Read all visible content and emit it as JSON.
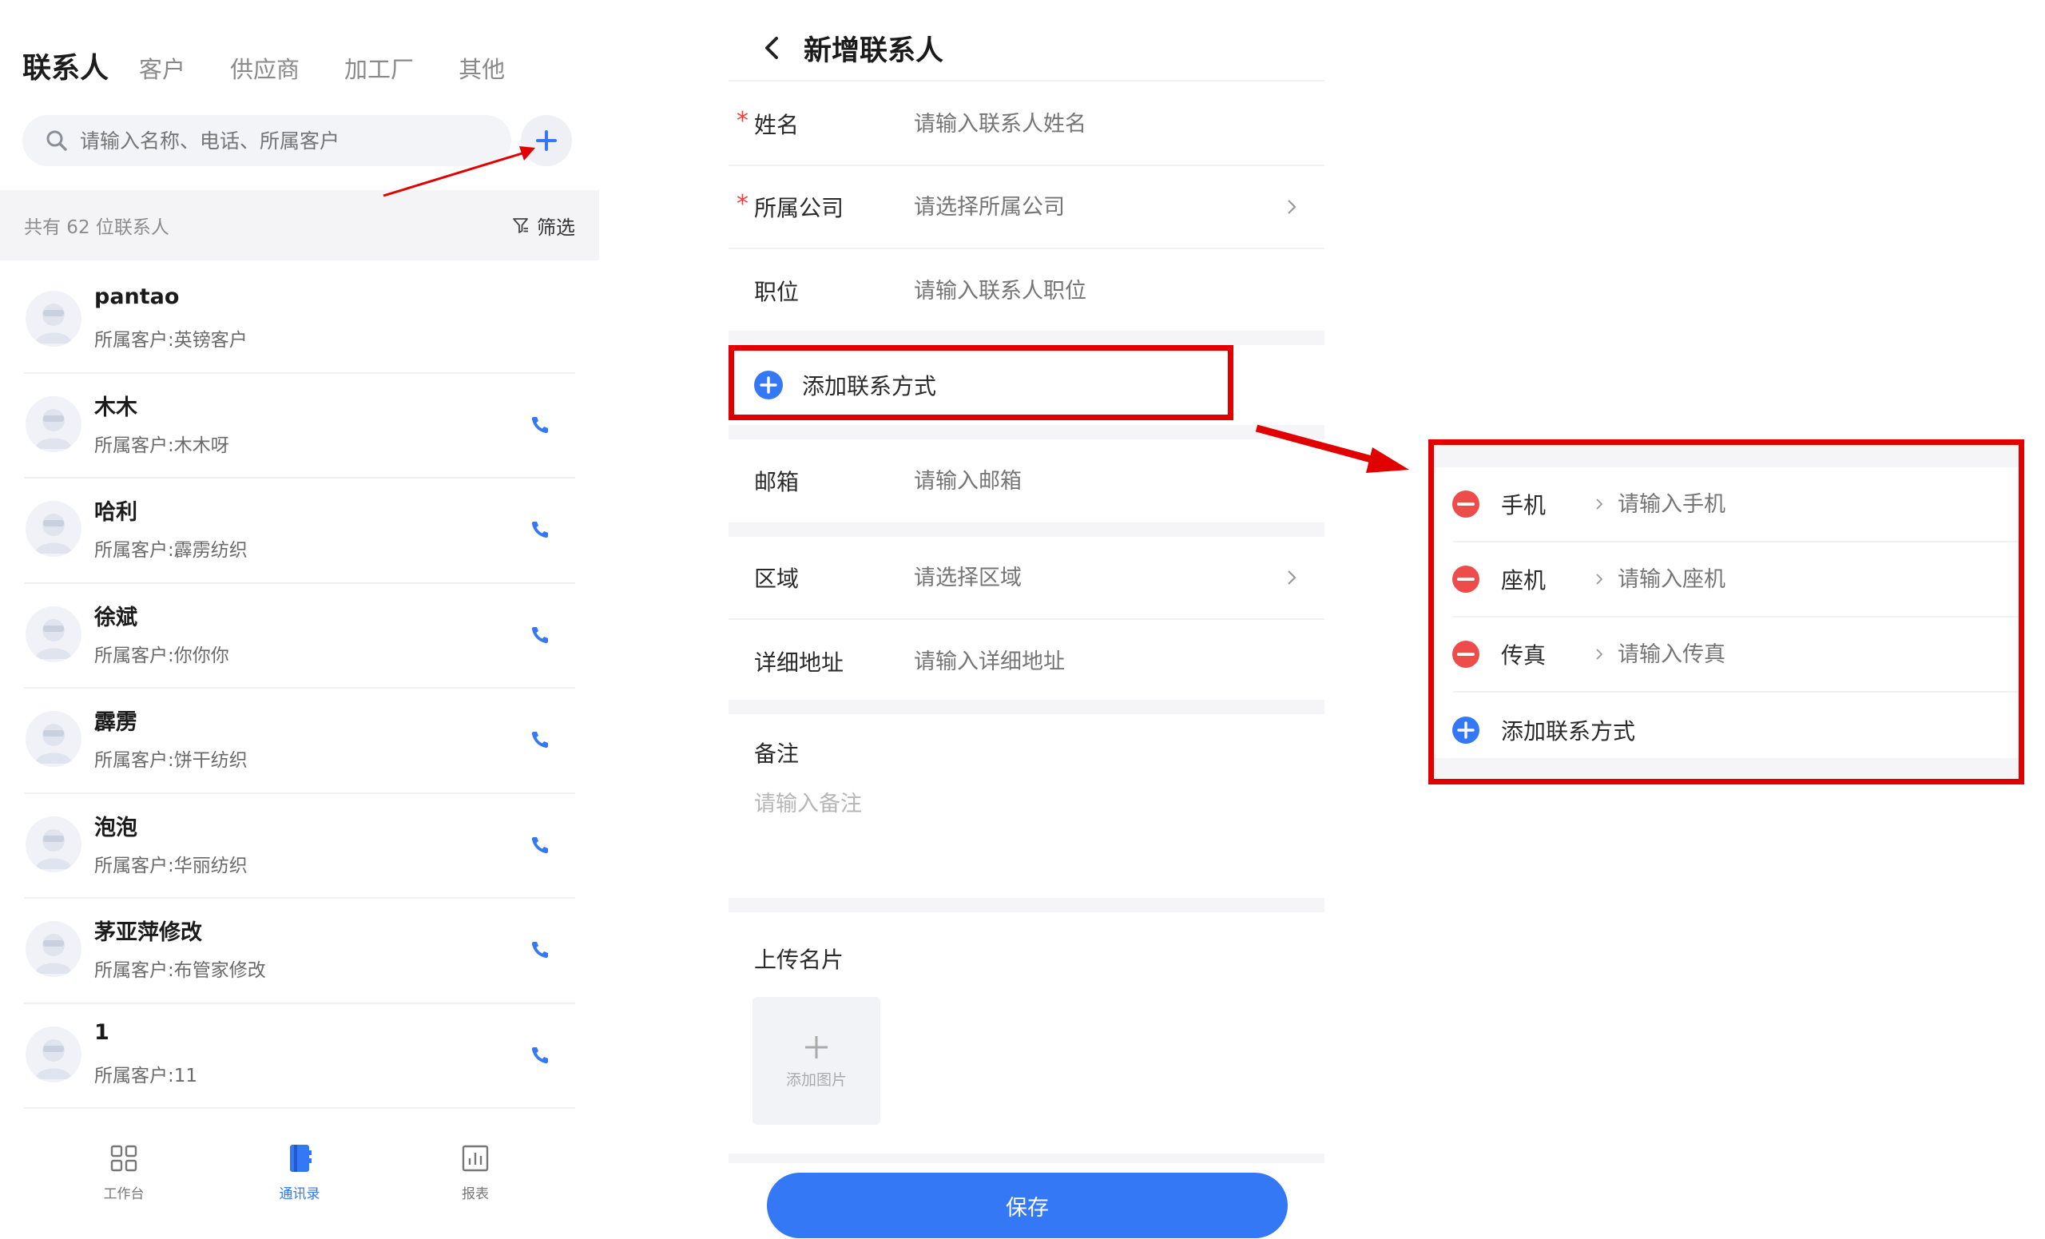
{
  "left": {
    "tabs": [
      {
        "label": "联系人",
        "active": true
      },
      {
        "label": "客户",
        "active": false
      },
      {
        "label": "供应商",
        "active": false
      },
      {
        "label": "加工厂",
        "active": false
      },
      {
        "label": "其他",
        "active": false
      }
    ],
    "search": {
      "placeholder": "请输入名称、电话、所属客户"
    },
    "count_text": "共有 62 位联系人",
    "filter_label": "筛选",
    "contacts": [
      {
        "name": "pantao",
        "company": "所属客户:英镑客户",
        "has_phone": false
      },
      {
        "name": "木木",
        "company": "所属客户:木木呀",
        "has_phone": true
      },
      {
        "name": "哈利",
        "company": "所属客户:霹雳纺织",
        "has_phone": true
      },
      {
        "name": "徐斌",
        "company": "所属客户:你你你",
        "has_phone": true
      },
      {
        "name": "霹雳",
        "company": "所属客户:饼干纺织",
        "has_phone": true
      },
      {
        "name": "泡泡",
        "company": "所属客户:华丽纺织",
        "has_phone": true
      },
      {
        "name": "茅亚萍修改",
        "company": "所属客户:布管家修改",
        "has_phone": true
      },
      {
        "name": "1",
        "company": "所属客户:11",
        "has_phone": true
      }
    ],
    "bottom_nav": [
      {
        "label": "工作台",
        "active": false
      },
      {
        "label": "通讯录",
        "active": true
      },
      {
        "label": "报表",
        "active": false
      }
    ]
  },
  "mid": {
    "title": "新增联系人",
    "fields": {
      "name": {
        "label": "姓名",
        "placeholder": "请输入联系人姓名"
      },
      "company": {
        "label": "所属公司",
        "placeholder": "请选择所属公司"
      },
      "position": {
        "label": "职位",
        "placeholder": "请输入联系人职位"
      },
      "email": {
        "label": "邮箱",
        "placeholder": "请输入邮箱"
      },
      "region": {
        "label": "区域",
        "placeholder": "请选择区域"
      },
      "address": {
        "label": "详细地址",
        "placeholder": "请输入详细地址"
      },
      "remark": {
        "label": "备注",
        "placeholder": "请输入备注"
      }
    },
    "add_contact_way": "添加联系方式",
    "upload_label": "上传名片",
    "upload_text": "添加图片",
    "save_label": "保存"
  },
  "right": {
    "ways": [
      {
        "label": "手机",
        "placeholder": "请输入手机"
      },
      {
        "label": "座机",
        "placeholder": "请输入座机"
      },
      {
        "label": "传真",
        "placeholder": "请输入传真"
      }
    ],
    "add_contact_way": "添加联系方式"
  },
  "colors": {
    "accent": "#3478f6",
    "required": "#f03e3e",
    "annotation": "#e00000",
    "remove": "#ee4b4b"
  }
}
